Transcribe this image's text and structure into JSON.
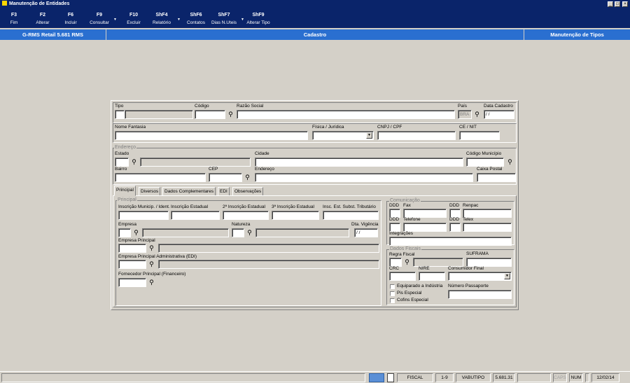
{
  "window": {
    "title": "Manutenção de Entidades",
    "min": "_",
    "max": "□",
    "close": "×"
  },
  "toolbar": [
    {
      "key": "F3",
      "label": "Fim"
    },
    {
      "key": "F2",
      "label": "Alterar"
    },
    {
      "key": "F6",
      "label": "Incluir"
    },
    {
      "key": "F9",
      "label": "Consultar"
    },
    {
      "key": "F10",
      "label": "Excluir"
    },
    {
      "key": "ShF4",
      "label": "Relatório"
    },
    {
      "key": "ShF6",
      "label": "Contatos"
    },
    {
      "key": "ShF7",
      "label": "Dias N.Uteis"
    },
    {
      "key": "ShF9",
      "label": "Alterar Tipo"
    }
  ],
  "infobar": {
    "app": "G-RMS Retail 5.681 RMS",
    "section": "Cadastro",
    "function": "Manutenção de Tipos"
  },
  "header": {
    "tipo": "Tipo",
    "codigo": "Código",
    "razao": "Razão Social",
    "pais": "País",
    "pais_value": "BRA",
    "data_cadastro": "Data Cadastro",
    "data_value": "/ /",
    "fantasia": "Nome Fantasia",
    "fisica": "Física / Jurídica",
    "cnpj": "CNPJ / CPF",
    "ce": "CE / NIT"
  },
  "endereco": {
    "title": "Endereço",
    "estado": "Estado",
    "cidade": "Cidade",
    "cod_municipio": "Código Município",
    "bairro": "Bairro",
    "cep": "CEP",
    "endereco": "Endereço",
    "caixa": "Caixa Postal"
  },
  "tabs": [
    "Principal",
    "Diversos",
    "Dados Complementares",
    "EDI",
    "Observações"
  ],
  "principal": {
    "title": "Principal",
    "insc_mun": "Inscrição Municip. / Ident.",
    "insc_est": "Inscrição Estadual",
    "insc_est2": "2ª Inscrição Estadual",
    "insc_est3": "3ª Inscrição Estadual",
    "insc_subst": "Insc. Est. Subst. Tributário",
    "empresa": "Empresa",
    "natureza": "Natureza",
    "dta_vig": "Dta. Vigência",
    "dta_value": "/ /",
    "emp_principal": "Empresa Principal",
    "emp_edi": "Empresa Principal Administrativa (EDI)",
    "fornecedor": "Fornecedor Principal (Financeiro)"
  },
  "comunicacao": {
    "title": "Comunicação",
    "ddd": "DDD",
    "fax": "Fax",
    "ddd2": "DDD",
    "renpac": "Renpac",
    "ddd3": "DDD",
    "telefone": "Telefone",
    "ddd4": "DDD",
    "telex": "Telex",
    "integracoes": "Integrações"
  },
  "fiscais": {
    "title": "Dados Fiscais",
    "regra": "Regra Fiscal",
    "suframa": "SUFRAMA",
    "crc": "CRC",
    "nire": "NIRE",
    "consumidor": "Consumidor Final",
    "equiparado": "Equiparado a Indústria",
    "passaporte": "Número Passaporte",
    "pis": "Pis Especial",
    "cofins": "Cofins Especial"
  },
  "status": {
    "fiscal": "FISCAL",
    "range": "1-9",
    "table": "VABUTIPO",
    "version": "5.681.31",
    "caps": "CAPS",
    "num": "NUM",
    "date": "12/02/14"
  }
}
